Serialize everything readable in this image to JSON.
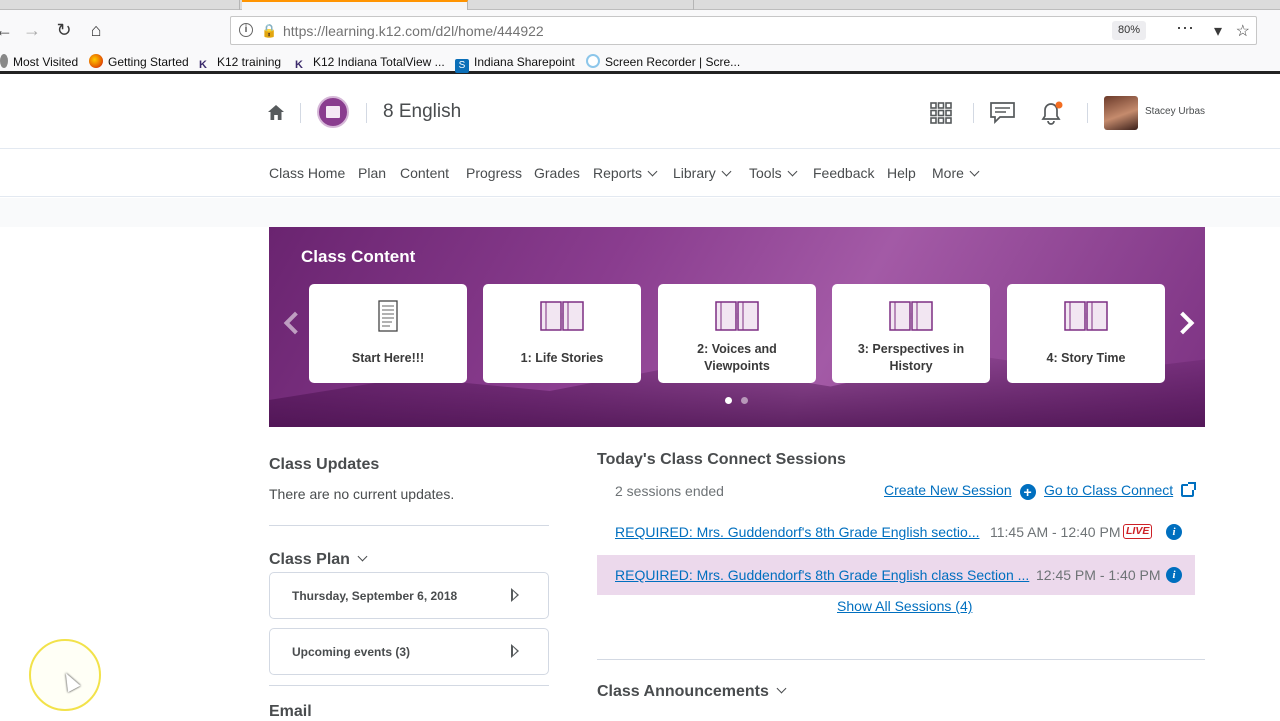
{
  "browser": {
    "url": "https://learning.k12.com/d2l/home/444922",
    "zoom": "80%",
    "bookmarks": [
      {
        "label": "Most Visited",
        "icon": "gear-icon"
      },
      {
        "label": "Getting Started",
        "icon": "firefox-icon"
      },
      {
        "label": "K12 training",
        "icon": "k12-icon"
      },
      {
        "label": "K12 Indiana TotalView ...",
        "icon": "k12-icon"
      },
      {
        "label": "Indiana Sharepoint",
        "icon": "sharepoint-icon"
      },
      {
        "label": "Screen Recorder | Scre...",
        "icon": "recorder-icon"
      }
    ]
  },
  "header": {
    "course_title": "8 English",
    "user_name": "Stacey Urbas"
  },
  "nav": {
    "items": [
      {
        "label": "Class Home"
      },
      {
        "label": "Plan"
      },
      {
        "label": "Content"
      },
      {
        "label": "Progress"
      },
      {
        "label": "Grades"
      },
      {
        "label": "Reports"
      },
      {
        "label": "Library"
      },
      {
        "label": "Tools"
      },
      {
        "label": "Feedback"
      },
      {
        "label": "Help"
      },
      {
        "label": "More"
      }
    ]
  },
  "banner": {
    "title": "Class Content",
    "cards": [
      {
        "label": "Start Here!!!"
      },
      {
        "label": "1: Life Stories"
      },
      {
        "label": "2: Voices and",
        "label2": "Viewpoints"
      },
      {
        "label": "3: Perspectives in",
        "label2": "History"
      },
      {
        "label": "4: Story Time"
      }
    ]
  },
  "class_updates": {
    "title": "Class Updates",
    "message": "There are no current updates."
  },
  "class_plan": {
    "title": "Class Plan",
    "items": [
      {
        "label": "Thursday, September 6, 2018"
      },
      {
        "label": "Upcoming events (3)"
      }
    ]
  },
  "email": {
    "title": "Email"
  },
  "sessions": {
    "title": "Today's Class Connect Sessions",
    "ended_text": "2 sessions ended",
    "create_label": "Create New Session",
    "goto_label": "Go to Class Connect",
    "rows": [
      {
        "title": "REQUIRED: Mrs. Guddendorf's 8th Grade English sectio...",
        "time": "11:45 AM - 12:40 PM",
        "badge": "LIVE"
      },
      {
        "title": "REQUIRED: Mrs. Guddendorf's 8th Grade English class Section ...",
        "time": "12:45 PM - 1:40 PM"
      }
    ],
    "show_all_label": "Show All Sessions (4)"
  },
  "announcements": {
    "title": "Class Announcements"
  },
  "colors": {
    "accent": "#006fbf",
    "banner": "#8a3d8f",
    "live": "#cd2026",
    "highlight_row": "#ecd9ec"
  }
}
